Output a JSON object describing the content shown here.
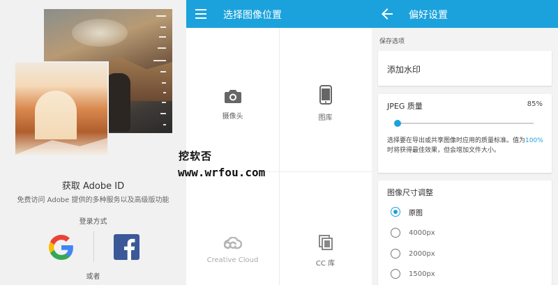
{
  "login_panel": {
    "title": "获取 Adobe ID",
    "subtitle": "免费访问 Adobe 提供的多种服务以及高级版功能",
    "login_methods_label": "登录方式",
    "or_label": "或者",
    "google_colors": [
      "#4285F4",
      "#EA4335",
      "#FBBC05",
      "#34A853"
    ],
    "facebook_color": "#3b5998"
  },
  "location_panel": {
    "appbar_title": "选择图像位置",
    "accent": "#1ba2dc",
    "tiles": [
      {
        "label": "摄像头",
        "icon": "camera-icon"
      },
      {
        "label": "图库",
        "icon": "phone-gallery-icon"
      },
      {
        "label": "Creative Cloud",
        "icon": "creative-cloud-icon"
      },
      {
        "label": "CC 库",
        "icon": "cc-library-icon"
      }
    ]
  },
  "preferences_panel": {
    "appbar_title": "偏好设置",
    "save_options_label": "保存选项",
    "watermark_label": "添加水印",
    "jpeg": {
      "label": "JPEG 质量",
      "value": "85%",
      "slider_fraction": 0.0,
      "desc_before": "选择要在导出或共享图像时应用的质量标准。值为",
      "desc_highlight": "100%",
      "desc_after": " 时将获得最佳效果，但会增加文件大小。"
    },
    "resize": {
      "header": "图像尺寸调整",
      "options": [
        {
          "label": "原图",
          "selected": true
        },
        {
          "label": "4000px",
          "selected": false
        },
        {
          "label": "2000px",
          "selected": false
        },
        {
          "label": "1500px",
          "selected": false
        }
      ]
    }
  },
  "watermark_overlay": {
    "site_name": "挖软否",
    "site_url": "www.wrfou.com"
  }
}
